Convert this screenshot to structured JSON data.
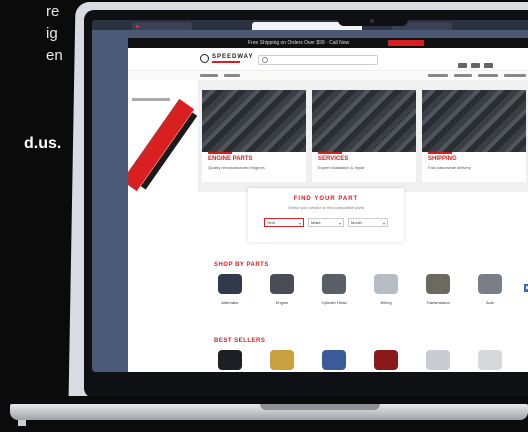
{
  "background_text": {
    "lines": [
      "re",
      "ig",
      "en"
    ],
    "domain_fragment": "d.us."
  },
  "browser": {
    "tabs": [
      {
        "label": "",
        "active": false
      },
      {
        "label": "",
        "active": true
      },
      {
        "label": "",
        "active": false
      }
    ]
  },
  "site": {
    "topbar_text": "Free Shipping on Orders Over $99  ·  Call Now",
    "logo": "SPEEDWAY",
    "search_placeholder": "Search parts...",
    "nav_count": 8
  },
  "hero_cards": [
    {
      "title": "ENGINE PARTS",
      "desc": "Quality remanufactured engines"
    },
    {
      "title": "SERVICES",
      "desc": "Expert installation & repair"
    },
    {
      "title": "SHIPPING",
      "desc": "Fast nationwide delivery"
    }
  ],
  "finder": {
    "title": "FIND YOUR PART",
    "subtitle": "Select your vehicle to find compatible parts",
    "selects": [
      "Year",
      "Make",
      "Model"
    ]
  },
  "sections": [
    {
      "title": "SHOP BY PARTS",
      "products": [
        {
          "label": "Alternator",
          "color": "#2f3a4c"
        },
        {
          "label": "Engine",
          "color": "#4a4d55"
        },
        {
          "label": "Cylinder Head",
          "color": "#5a5e66"
        },
        {
          "label": "Wiring",
          "color": "#b8bcc4"
        },
        {
          "label": "Transmission",
          "color": "#6c6a60"
        },
        {
          "label": "Axle",
          "color": "#7a7e86"
        }
      ]
    },
    {
      "title": "BEST SELLERS",
      "products": [
        {
          "label": "Gasket Kit",
          "color": "#1d1f24"
        },
        {
          "label": "Fuel Injector",
          "color": "#c9a040"
        },
        {
          "label": "Starter Motor",
          "color": "#3a5a9a"
        },
        {
          "label": "Timing Belt",
          "color": "#8a1a1a"
        },
        {
          "label": "Water Pump",
          "color": "#c8ccd2"
        },
        {
          "label": "Pulley",
          "color": "#d6d8dc"
        }
      ]
    }
  ]
}
